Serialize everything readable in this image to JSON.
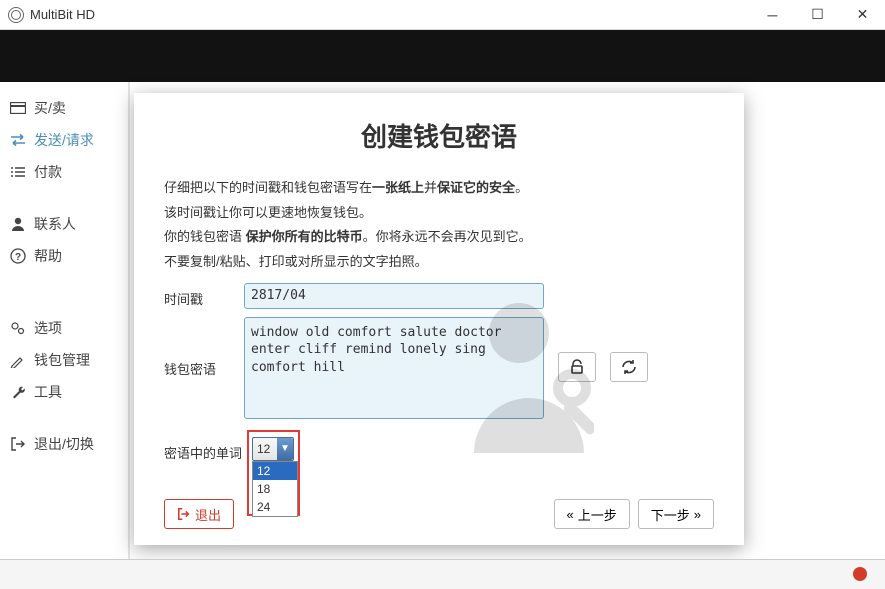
{
  "window": {
    "title": "MultiBit HD"
  },
  "sidebar": {
    "items": [
      {
        "label": "买/卖"
      },
      {
        "label": "发送/请求"
      },
      {
        "label": "付款"
      },
      {
        "label": "联系人"
      },
      {
        "label": "帮助"
      },
      {
        "label": "选项"
      },
      {
        "label": "钱包管理"
      },
      {
        "label": "工具"
      },
      {
        "label": "退出/切换"
      }
    ]
  },
  "modal": {
    "title": "创建钱包密语",
    "line1a": "仔细把以下的时间戳和钱包密语写在",
    "line1b": "一张纸上",
    "line1c": "并",
    "line1d": "保证它的安全",
    "line1e": "。",
    "line2": "该时间戳让你可以更速地恢复钱包。",
    "line3a": "你的钱包密语 ",
    "line3b": "保护你所有的比特币",
    "line3c": "。你将永远不会再次见到它。",
    "line4": "不要复制/粘贴、打印或对所显示的文字拍照。",
    "field_timestamp": "时间戳",
    "timestamp_value": "2817/04",
    "field_seed": "钱包密语",
    "seed_value": "window old comfort salute doctor enter cliff remind lonely sing comfort hill",
    "field_count": "密语中的单词",
    "selected_count": "12",
    "options": [
      "12",
      "18",
      "24"
    ],
    "btn_exit": "退出",
    "btn_prev": "上一步",
    "btn_next": "下一步"
  }
}
